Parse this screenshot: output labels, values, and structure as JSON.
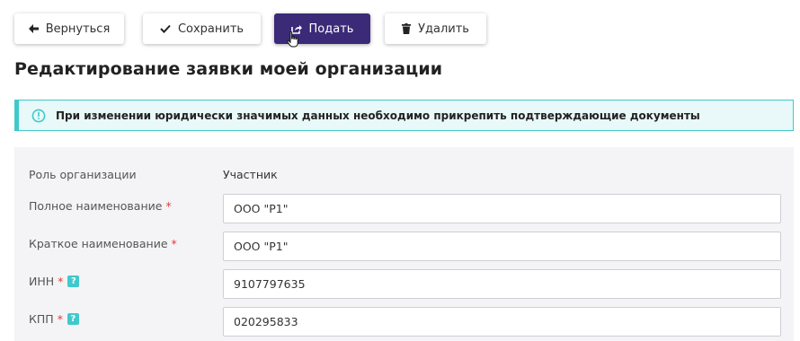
{
  "toolbar": {
    "back_label": "Вернуться",
    "save_label": "Сохранить",
    "submit_label": "Подать",
    "delete_label": "Удалить"
  },
  "page": {
    "title": "Редактирование заявки моей организации"
  },
  "alert": {
    "text": "При изменении юридически значимых данных необходимо прикрепить подтверждающие документы"
  },
  "form": {
    "role": {
      "label": "Роль организации",
      "value": "Участник"
    },
    "full_name": {
      "label": "Полное наименование",
      "required_mark": "*",
      "value": "ООО \"Р1\""
    },
    "short_name": {
      "label": "Краткое наименование",
      "required_mark": "*",
      "value": "ООО \"Р1\""
    },
    "inn": {
      "label": "ИНН",
      "required_mark": "*",
      "help": "?",
      "value": "9107797635"
    },
    "kpp": {
      "label": "КПП",
      "required_mark": "*",
      "help": "?",
      "value": "020295833"
    }
  },
  "icons": {
    "back": "arrow-left-icon",
    "save": "check-icon",
    "submit": "share-icon",
    "delete": "trash-icon",
    "alert": "exclamation-circle-icon",
    "help": "question-icon"
  },
  "colors": {
    "primary": "#3b2a78",
    "info_accent": "#40c9cc",
    "info_bg": "#e9f8f8",
    "required": "#e5393b",
    "panel_bg": "#f4f4f6"
  }
}
